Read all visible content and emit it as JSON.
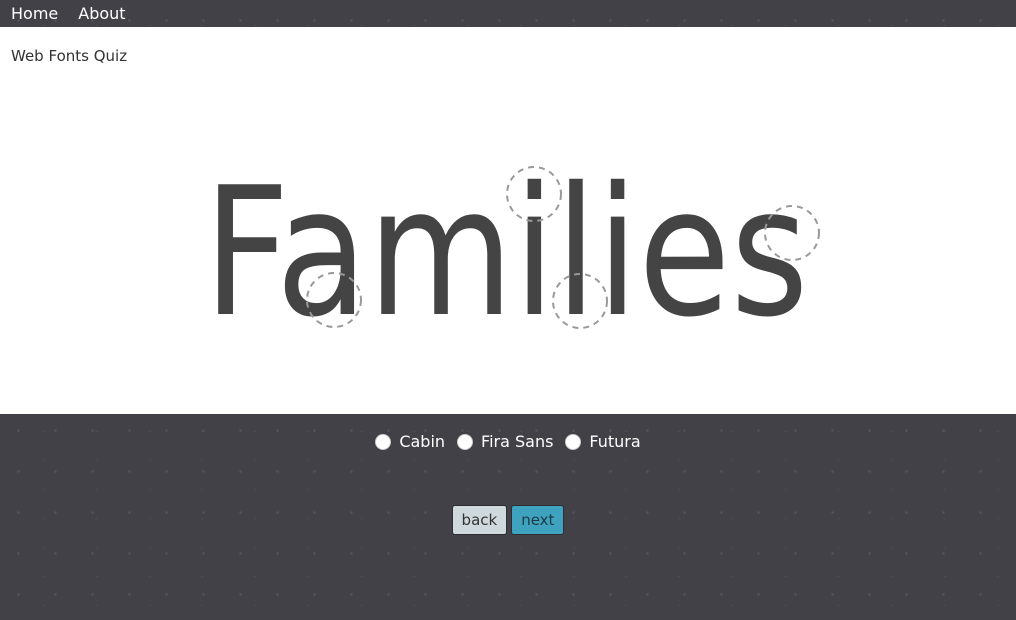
{
  "nav": {
    "items": [
      {
        "label": "Home"
      },
      {
        "label": "About"
      }
    ]
  },
  "page": {
    "title": "Web Fonts Quiz"
  },
  "specimen": {
    "word": "Families"
  },
  "quiz": {
    "options": [
      {
        "label": "Cabin",
        "selected": false
      },
      {
        "label": "Fira Sans",
        "selected": false
      },
      {
        "label": "Futura",
        "selected": false
      }
    ]
  },
  "buttons": {
    "back_label": "back",
    "next_label": "next"
  },
  "colors": {
    "background_dark": "#424148",
    "panel": "#ffffff",
    "specimen_text": "#444444",
    "back_button": "#cfd8dc",
    "next_button": "#3fa3bf"
  }
}
